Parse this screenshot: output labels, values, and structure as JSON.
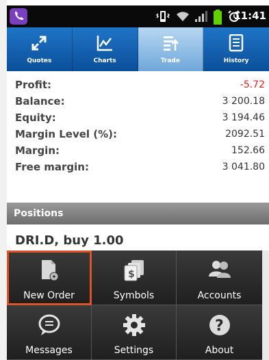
{
  "status_bar": {
    "time": "11:41"
  },
  "tabs": [
    {
      "label": "Quotes",
      "icon": "quotes-icon",
      "active": false
    },
    {
      "label": "Charts",
      "icon": "charts-icon",
      "active": false
    },
    {
      "label": "Trade",
      "icon": "trade-icon",
      "active": true
    },
    {
      "label": "History",
      "icon": "history-icon",
      "active": false
    }
  ],
  "summary": [
    {
      "label": "Profit:",
      "value": "-5.72"
    },
    {
      "label": "Balance:",
      "value": "3 200.18"
    },
    {
      "label": "Equity:",
      "value": "3 194.46"
    },
    {
      "label": "Margin Level (%):",
      "value": "2092.51"
    },
    {
      "label": "Margin:",
      "value": "152.66"
    },
    {
      "label": "Free margin:",
      "value": "3 041.80"
    }
  ],
  "positions": {
    "header": "Positions",
    "item_title": "DRI.D, buy 1.00"
  },
  "menu": [
    {
      "label": "New Order",
      "icon": "new-order-icon",
      "selected": true
    },
    {
      "label": "Symbols",
      "icon": "symbols-icon",
      "selected": false
    },
    {
      "label": "Accounts",
      "icon": "accounts-icon",
      "selected": false
    },
    {
      "label": "Messages",
      "icon": "messages-icon",
      "selected": false
    },
    {
      "label": "Settings",
      "icon": "settings-icon",
      "selected": false
    },
    {
      "label": "About",
      "icon": "about-icon",
      "selected": false
    }
  ],
  "colors": {
    "tab_bar": "#1f74c6",
    "tab_active": "#9cc6ea",
    "negative": "#e02020",
    "menu_selected": "#e0532a"
  }
}
